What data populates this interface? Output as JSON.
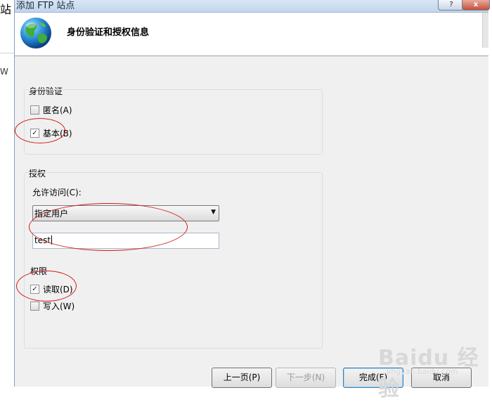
{
  "background_window": {
    "title_fragment": "站",
    "side_text": "W"
  },
  "dialog": {
    "title": "添加 FTP 站点",
    "help_glyph": "?",
    "close_glyph": "x",
    "heading": "身份验证和授权信息"
  },
  "authentication": {
    "group_label": "身份验证",
    "anonymous": {
      "label": "匿名(A)",
      "checked": false
    },
    "basic": {
      "label": "基本(B)",
      "checked": true
    }
  },
  "authorization": {
    "group_label": "授权",
    "allow_access_label": "允许访问(C):",
    "allow_access_selected": "指定用户",
    "user_value": "test"
  },
  "permissions": {
    "label": "权限",
    "read": {
      "label": "读取(D)",
      "checked": true
    },
    "write": {
      "label": "写入(W)",
      "checked": false
    }
  },
  "buttons": {
    "previous": "上一页(P)",
    "next": "下一步(N)",
    "finish": "完成(F)",
    "cancel": "取消"
  },
  "watermark": {
    "text": "Baidu 经验",
    "sub": "jingyan.baidu.com"
  },
  "colors": {
    "annotation_red": "#d21a1a",
    "dialog_bg": "#f0f0f0",
    "group_border": "#d5dfe5"
  },
  "icons": {
    "header": "globe-icon",
    "combo": "dropdown-arrow-icon",
    "check": "checkmark-icon"
  }
}
